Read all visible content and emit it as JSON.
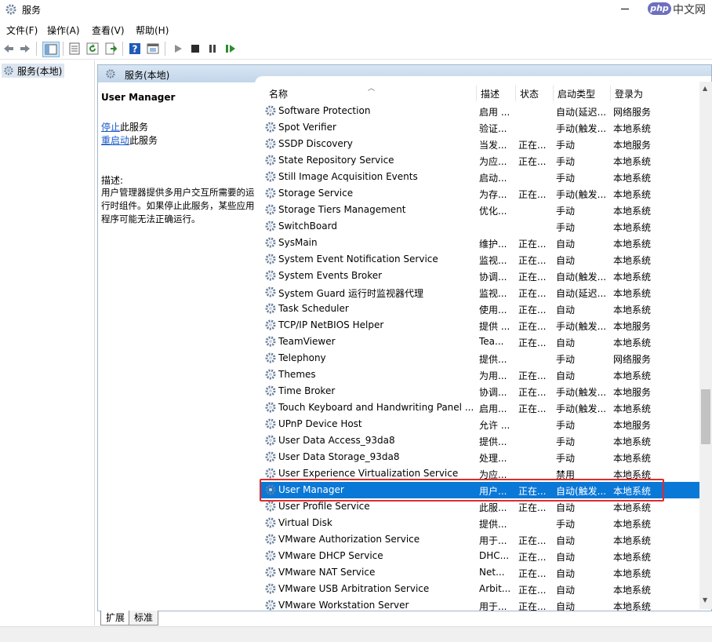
{
  "window": {
    "title": "服务",
    "watermark_php": "php",
    "watermark_text": "中文网"
  },
  "menu": [
    "文件(F)",
    "操作(A)",
    "查看(V)",
    "帮助(H)"
  ],
  "tree": {
    "item": "服务(本地)"
  },
  "pane": {
    "title": "服务(本地)",
    "selected_service": "User Manager",
    "stop_link": "停止",
    "stop_suffix": "此服务",
    "restart_link": "重启动",
    "restart_suffix": "此服务",
    "desc_label": "描述:",
    "desc_text": "用户管理器提供多用户交互所需要的运行时组件。如果停止此服务，某些应用程序可能无法正确运行。"
  },
  "columns": {
    "name": "名称",
    "desc": "描述",
    "status": "状态",
    "startup": "启动类型",
    "logon": "登录为"
  },
  "rows": [
    {
      "name": "Software Protection",
      "desc": "启用 ...",
      "status": "",
      "startup": "自动(延迟...",
      "logon": "网络服务"
    },
    {
      "name": "Spot Verifier",
      "desc": "验证...",
      "status": "",
      "startup": "手动(触发...",
      "logon": "本地系统"
    },
    {
      "name": "SSDP Discovery",
      "desc": "当发...",
      "status": "正在...",
      "startup": "手动",
      "logon": "本地服务"
    },
    {
      "name": "State Repository Service",
      "desc": "为应...",
      "status": "正在...",
      "startup": "手动",
      "logon": "本地系统"
    },
    {
      "name": "Still Image Acquisition Events",
      "desc": "启动...",
      "status": "",
      "startup": "手动",
      "logon": "本地系统"
    },
    {
      "name": "Storage Service",
      "desc": "为存...",
      "status": "正在...",
      "startup": "手动(触发...",
      "logon": "本地系统"
    },
    {
      "name": "Storage Tiers Management",
      "desc": "优化...",
      "status": "",
      "startup": "手动",
      "logon": "本地系统"
    },
    {
      "name": "SwitchBoard",
      "desc": "",
      "status": "",
      "startup": "手动",
      "logon": "本地系统"
    },
    {
      "name": "SysMain",
      "desc": "维护...",
      "status": "正在...",
      "startup": "自动",
      "logon": "本地系统"
    },
    {
      "name": "System Event Notification Service",
      "desc": "监视...",
      "status": "正在...",
      "startup": "自动",
      "logon": "本地系统"
    },
    {
      "name": "System Events Broker",
      "desc": "协调...",
      "status": "正在...",
      "startup": "自动(触发...",
      "logon": "本地系统"
    },
    {
      "name": "System Guard 运行时监视器代理",
      "desc": "监视...",
      "status": "正在...",
      "startup": "自动(延迟...",
      "logon": "本地系统"
    },
    {
      "name": "Task Scheduler",
      "desc": "使用...",
      "status": "正在...",
      "startup": "自动",
      "logon": "本地系统"
    },
    {
      "name": "TCP/IP NetBIOS Helper",
      "desc": "提供 ...",
      "status": "正在...",
      "startup": "手动(触发...",
      "logon": "本地服务"
    },
    {
      "name": "TeamViewer",
      "desc": "Tea...",
      "status": "正在...",
      "startup": "自动",
      "logon": "本地系统"
    },
    {
      "name": "Telephony",
      "desc": "提供...",
      "status": "",
      "startup": "手动",
      "logon": "网络服务"
    },
    {
      "name": "Themes",
      "desc": "为用...",
      "status": "正在...",
      "startup": "自动",
      "logon": "本地系统"
    },
    {
      "name": "Time Broker",
      "desc": "协调...",
      "status": "正在...",
      "startup": "手动(触发...",
      "logon": "本地服务"
    },
    {
      "name": "Touch Keyboard and Handwriting Panel ...",
      "desc": "启用...",
      "status": "正在...",
      "startup": "手动(触发...",
      "logon": "本地系统"
    },
    {
      "name": "UPnP Device Host",
      "desc": "允许 ...",
      "status": "",
      "startup": "手动",
      "logon": "本地服务"
    },
    {
      "name": "User Data Access_93da8",
      "desc": "提供...",
      "status": "",
      "startup": "手动",
      "logon": "本地系统"
    },
    {
      "name": "User Data Storage_93da8",
      "desc": "处理...",
      "status": "",
      "startup": "手动",
      "logon": "本地系统"
    },
    {
      "name": "User Experience Virtualization Service",
      "desc": "为应...",
      "status": "",
      "startup": "禁用",
      "logon": "本地系统"
    },
    {
      "name": "User Manager",
      "desc": "用户...",
      "status": "正在...",
      "startup": "自动(触发...",
      "logon": "本地系统"
    },
    {
      "name": "User Profile Service",
      "desc": "此服...",
      "status": "正在...",
      "startup": "自动",
      "logon": "本地系统"
    },
    {
      "name": "Virtual Disk",
      "desc": "提供...",
      "status": "",
      "startup": "手动",
      "logon": "本地系统"
    },
    {
      "name": "VMware Authorization Service",
      "desc": "用于...",
      "status": "正在...",
      "startup": "自动",
      "logon": "本地系统"
    },
    {
      "name": "VMware DHCP Service",
      "desc": "DHC...",
      "status": "正在...",
      "startup": "自动",
      "logon": "本地系统"
    },
    {
      "name": "VMware NAT Service",
      "desc": "Net...",
      "status": "正在...",
      "startup": "自动",
      "logon": "本地系统"
    },
    {
      "name": "VMware USB Arbitration Service",
      "desc": "Arbit...",
      "status": "正在...",
      "startup": "自动",
      "logon": "本地系统"
    },
    {
      "name": "VMware Workstation Server",
      "desc": "用于...",
      "status": "正在...",
      "startup": "自动",
      "logon": "本地系统"
    }
  ],
  "selected_index": 23,
  "tabs": [
    "扩展",
    "标准"
  ],
  "colors": {
    "selection": "#0a78d7",
    "highlight_box": "#e02b2b",
    "header_bg": "#c2d5ea"
  }
}
